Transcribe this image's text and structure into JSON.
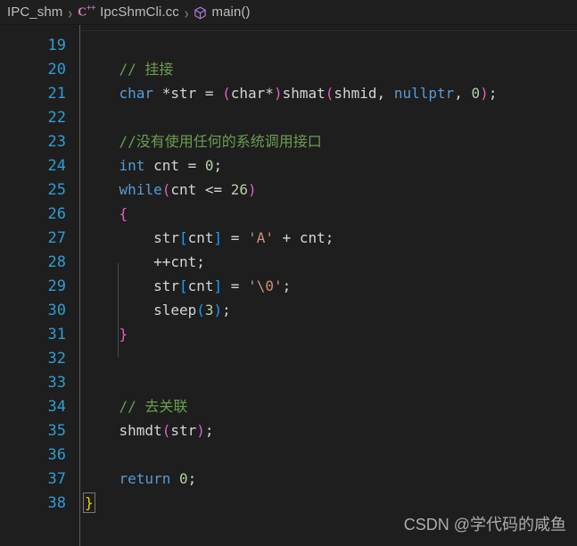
{
  "breadcrumb": {
    "project": "IPC_shm",
    "file": "IpcShmCli.cc",
    "symbol": "main()",
    "separator": "›",
    "cpp_icon_label": "C",
    "cpp_icon_sup": "++",
    "icons": {
      "cpp": "cpp-file-icon",
      "cube": "symbol-method-cube-icon"
    }
  },
  "editor": {
    "language": "cpp",
    "first_visible_line": 19,
    "last_visible_line": 38,
    "lines": [
      {
        "n": "19",
        "tokens": []
      },
      {
        "n": "20",
        "tokens": [
          {
            "t": "    ",
            "c": "plain"
          },
          {
            "t": "// 挂接",
            "c": "cmt"
          }
        ]
      },
      {
        "n": "21",
        "tokens": [
          {
            "t": "    ",
            "c": "plain"
          },
          {
            "t": "char",
            "c": "kw"
          },
          {
            "t": " *str = ",
            "c": "plain"
          },
          {
            "t": "(",
            "c": "p1"
          },
          {
            "t": "char*",
            "c": "plain"
          },
          {
            "t": ")",
            "c": "p1"
          },
          {
            "t": "shmat",
            "c": "plain"
          },
          {
            "t": "(",
            "c": "p1"
          },
          {
            "t": "shmid, ",
            "c": "plain"
          },
          {
            "t": "nullptr",
            "c": "kw"
          },
          {
            "t": ", ",
            "c": "plain"
          },
          {
            "t": "0",
            "c": "num"
          },
          {
            "t": ")",
            "c": "p1"
          },
          {
            "t": ";",
            "c": "plain"
          }
        ]
      },
      {
        "n": "22",
        "tokens": []
      },
      {
        "n": "23",
        "tokens": [
          {
            "t": "    ",
            "c": "plain"
          },
          {
            "t": "//没有使用任何的系统调用接口",
            "c": "cmt"
          }
        ]
      },
      {
        "n": "24",
        "tokens": [
          {
            "t": "    ",
            "c": "plain"
          },
          {
            "t": "int",
            "c": "kw"
          },
          {
            "t": " cnt = ",
            "c": "plain"
          },
          {
            "t": "0",
            "c": "num"
          },
          {
            "t": ";",
            "c": "plain"
          }
        ]
      },
      {
        "n": "25",
        "tokens": [
          {
            "t": "    ",
            "c": "plain"
          },
          {
            "t": "while",
            "c": "kw"
          },
          {
            "t": "(",
            "c": "p1"
          },
          {
            "t": "cnt <= ",
            "c": "plain"
          },
          {
            "t": "26",
            "c": "num"
          },
          {
            "t": ")",
            "c": "p1"
          }
        ]
      },
      {
        "n": "26",
        "tokens": [
          {
            "t": "    ",
            "c": "plain"
          },
          {
            "t": "{",
            "c": "p1"
          }
        ]
      },
      {
        "n": "27",
        "tokens": [
          {
            "t": "        ",
            "c": "plain"
          },
          {
            "t": "str",
            "c": "plain"
          },
          {
            "t": "[",
            "c": "p2"
          },
          {
            "t": "cnt",
            "c": "plain"
          },
          {
            "t": "]",
            "c": "p2"
          },
          {
            "t": " = ",
            "c": "plain"
          },
          {
            "t": "'A'",
            "c": "str"
          },
          {
            "t": " + cnt;",
            "c": "plain"
          }
        ]
      },
      {
        "n": "28",
        "tokens": [
          {
            "t": "        ",
            "c": "plain"
          },
          {
            "t": "++cnt;",
            "c": "plain"
          }
        ]
      },
      {
        "n": "29",
        "tokens": [
          {
            "t": "        ",
            "c": "plain"
          },
          {
            "t": "str",
            "c": "plain"
          },
          {
            "t": "[",
            "c": "p2"
          },
          {
            "t": "cnt",
            "c": "plain"
          },
          {
            "t": "]",
            "c": "p2"
          },
          {
            "t": " = ",
            "c": "plain"
          },
          {
            "t": "'\\0'",
            "c": "str"
          },
          {
            "t": ";",
            "c": "plain"
          }
        ]
      },
      {
        "n": "30",
        "tokens": [
          {
            "t": "        ",
            "c": "plain"
          },
          {
            "t": "sleep",
            "c": "plain"
          },
          {
            "t": "(",
            "c": "p2"
          },
          {
            "t": "3",
            "c": "num"
          },
          {
            "t": ")",
            "c": "p2"
          },
          {
            "t": ";",
            "c": "plain"
          }
        ]
      },
      {
        "n": "31",
        "tokens": [
          {
            "t": "    ",
            "c": "plain"
          },
          {
            "t": "}",
            "c": "p1"
          }
        ]
      },
      {
        "n": "32",
        "tokens": []
      },
      {
        "n": "33",
        "tokens": []
      },
      {
        "n": "34",
        "tokens": [
          {
            "t": "    ",
            "c": "plain"
          },
          {
            "t": "// 去关联",
            "c": "cmt"
          }
        ]
      },
      {
        "n": "35",
        "tokens": [
          {
            "t": "    ",
            "c": "plain"
          },
          {
            "t": "shmdt",
            "c": "plain"
          },
          {
            "t": "(",
            "c": "p1"
          },
          {
            "t": "str",
            "c": "plain"
          },
          {
            "t": ")",
            "c": "p1"
          },
          {
            "t": ";",
            "c": "plain"
          }
        ]
      },
      {
        "n": "36",
        "tokens": []
      },
      {
        "n": "37",
        "tokens": [
          {
            "t": "    ",
            "c": "plain"
          },
          {
            "t": "return",
            "c": "kw"
          },
          {
            "t": " ",
            "c": "plain"
          },
          {
            "t": "0",
            "c": "num"
          },
          {
            "t": ";",
            "c": "plain"
          }
        ]
      },
      {
        "n": "38",
        "tokens": [
          {
            "t": "}",
            "c": "brace-hl"
          }
        ]
      }
    ]
  },
  "watermark": {
    "text": "CSDN @学代码的咸鱼"
  },
  "colors": {
    "editor_background": "#1e1e1e",
    "breadcrumb_background": "#1f1f1f",
    "line_number": "#2b9fd4",
    "comment": "#6a9e4f",
    "keyword": "#569cd6",
    "number": "#b5cea8",
    "string": "#ce9178",
    "bracket_level1": "#e060c0",
    "bracket_level2": "#179fff",
    "matching_brace": "#f3d000",
    "foreground": "#d4d4d4"
  }
}
